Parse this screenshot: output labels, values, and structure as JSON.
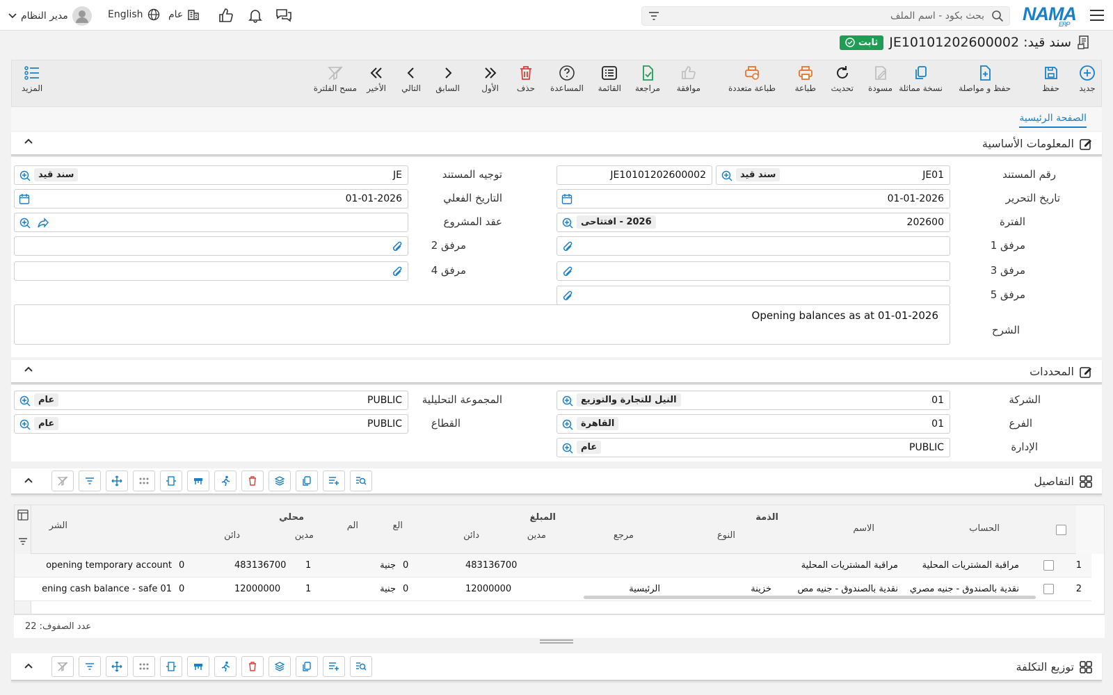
{
  "topbar": {
    "logo": "NAMA",
    "logo_sub": "ERP",
    "search_placeholder": "بحث بكود - اسم الملف",
    "company": "عام",
    "language": "English",
    "user": "مدير النظام"
  },
  "document": {
    "title": "سند قيد: JE10101202600002",
    "status": "ثابت"
  },
  "toolbar": {
    "new": "جديد",
    "save": "حفظ",
    "save_continue": "حفظ و مواصلة",
    "duplicate": "نسخة مماثلة",
    "draft": "مسودة",
    "refresh": "تحديث",
    "print": "طباعة",
    "multi_print": "طباعة متعددة",
    "approve": "موافقة",
    "review": "مراجعة",
    "list": "القائمة",
    "help": "المساعدة",
    "delete": "حذف",
    "first": "الأول",
    "prev": "السابق",
    "next": "التالي",
    "last": "الأخير",
    "clear_filter": "مسح الفلترة",
    "more": "المزيد"
  },
  "tabs": {
    "main": "الصفحة الرئيسية"
  },
  "basic": {
    "section_title": "المعلومات الأساسية",
    "doc_number_label": "رقم المستند",
    "doc_number_code": "JE01",
    "doc_number_chip": "سند قيد",
    "doc_number_value": "JE10101202600002",
    "doc_direction_label": "توجيه المستند",
    "doc_direction_value": "JE",
    "doc_direction_chip": "سند قيد",
    "edit_date_label": "تاريخ التحرير",
    "edit_date_value": "01-01-2026",
    "actual_date_label": "التاريخ الفعلي",
    "actual_date_value": "01-01-2026",
    "period_label": "الفترة",
    "period_value": "202600",
    "period_chip": "2026 - افتتاحى",
    "project_label": "عقد المشروع",
    "att1_label": "مرفق 1",
    "att2_label": "مرفق 2",
    "att3_label": "مرفق 3",
    "att4_label": "مرفق 4",
    "att5_label": "مرفق 5",
    "remarks_label": "الشرح",
    "remarks_value": "Opening balances as at 01-01-2026"
  },
  "dimensions": {
    "section_title": "المحددات",
    "company_label": "الشركة",
    "company_code": "01",
    "company_chip": "النيل للتجارة والتوزيع",
    "analysis_label": "المجموعة التحليلية",
    "analysis_code": "PUBLIC",
    "analysis_chip": "عام",
    "branch_label": "الفرع",
    "branch_code": "01",
    "branch_chip": "القاهرة",
    "sector_label": "القطاع",
    "sector_code": "PUBLIC",
    "sector_chip": "عام",
    "dept_label": "الإدارة",
    "dept_code": "PUBLIC",
    "dept_chip": "عام"
  },
  "details": {
    "section_title": "التفاصيل",
    "headers": {
      "account": "الحساب",
      "name": "الاسم",
      "subsidiary": "الذمة",
      "type": "النوع",
      "ref": "مرجع",
      "amount": "المبلغ",
      "debit": "مدين",
      "credit": "دائن",
      "currency": "الع",
      "rate": "الم",
      "local": "محلي",
      "local_debit": "مدين",
      "local_credit": "دائن",
      "narration": "الشر"
    },
    "rows": [
      {
        "n": "1",
        "account": "مراقبة المشتريات المحلية",
        "name": "مراقبة المشتريات المحلية",
        "type": "",
        "ref": "",
        "debit": "483136700",
        "credit": "0",
        "currency": "جنية",
        "rate": "1",
        "local_debit": "483136700",
        "local_credit": "0",
        "narration": "opening temporary account"
      },
      {
        "n": "2",
        "account": "نقدية بالصندوق - جنيه مصري",
        "name": "نقدية بالصندوق - جنيه مص",
        "type": "خزينة",
        "ref": "الرئيسية",
        "debit": "12000000",
        "credit": "0",
        "currency": "جنية",
        "rate": "1",
        "local_debit": "12000000",
        "local_credit": "0",
        "narration": "ening cash balance - safe 01"
      }
    ],
    "row_count": "عدد الصفوف: 22"
  },
  "cost": {
    "section_title": "توزيع التكلفة"
  },
  "colors": {
    "accent": "#1a7fc4",
    "success": "#1f9d55",
    "danger": "#d9413b",
    "orange": "#e8742a"
  }
}
